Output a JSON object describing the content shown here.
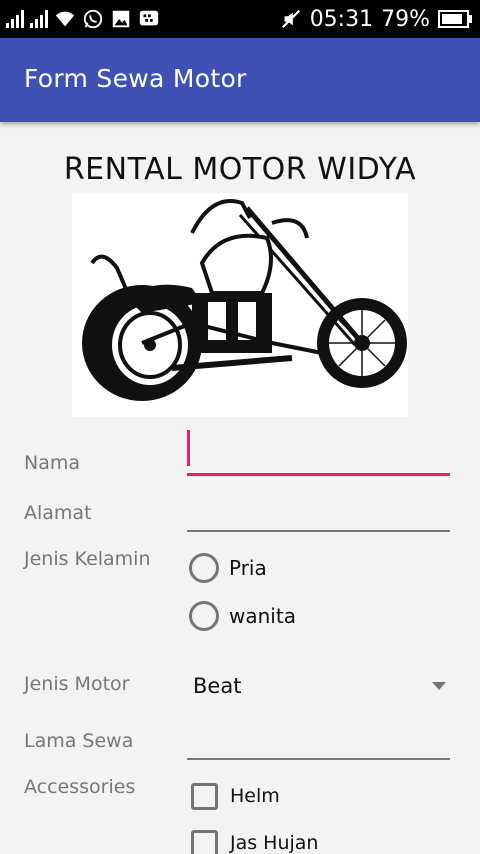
{
  "status_bar": {
    "time": "05:31",
    "battery": "79%",
    "icons": [
      "signal-1-icon",
      "signal-2-icon",
      "wifi-icon",
      "whatsapp-icon",
      "image-icon",
      "bbm-icon",
      "mute-icon",
      "battery-icon"
    ]
  },
  "app_bar": {
    "title": "Form Sewa Motor"
  },
  "heading": "RENTAL MOTOR WIDYA",
  "form": {
    "nama": {
      "label": "Nama",
      "value": ""
    },
    "alamat": {
      "label": "Alamat",
      "value": ""
    },
    "jenis_kelamin": {
      "label": "Jenis Kelamin",
      "options": [
        "Pria",
        "wanita"
      ]
    },
    "jenis_motor": {
      "label": "Jenis Motor",
      "selected": "Beat"
    },
    "lama_sewa": {
      "label": "Lama Sewa",
      "value": ""
    },
    "accessories": {
      "label": "Accessories",
      "options": [
        "Helm",
        "Jas Hujan"
      ]
    }
  },
  "colors": {
    "primary": "#3f51b5",
    "accent": "#e91e63",
    "background": "#f3f3f3"
  }
}
